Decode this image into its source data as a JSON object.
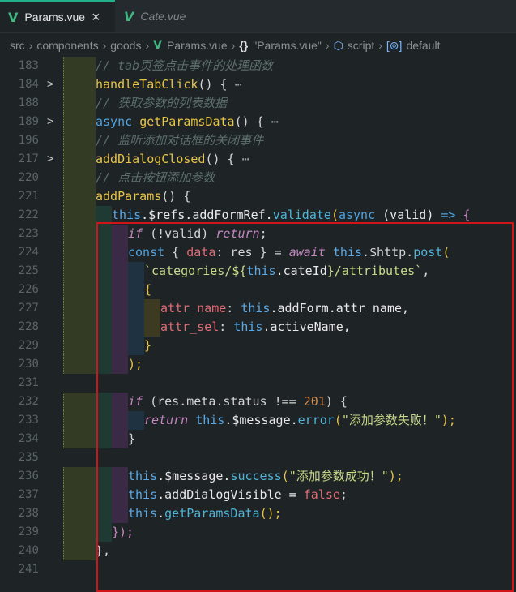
{
  "tabs": [
    {
      "label": "Params.vue",
      "active": true,
      "close": "×",
      "icon": "V"
    },
    {
      "label": "Cate.vue",
      "active": false,
      "icon": "V"
    }
  ],
  "breadcrumb": {
    "items": [
      "src",
      "components",
      "goods",
      "Params.vue",
      "\"Params.vue\"",
      "script",
      "default"
    ],
    "braces": "{}",
    "cube": "⬡",
    "field": "[⊚]"
  },
  "editor": {
    "line_numbers": [
      "183",
      "184",
      "188",
      "189",
      "196",
      "217",
      "220",
      "221",
      "222",
      "223",
      "224",
      "225",
      "226",
      "227",
      "228",
      "229",
      "230",
      "231",
      "232",
      "233",
      "234",
      "235",
      "236",
      "237",
      "238",
      "239",
      "240",
      "241"
    ]
  },
  "code": {
    "l183_comment": "// tab页签点击事件的处理函数",
    "l184_fn": "handleTabClick",
    "l184_rest": "() { ",
    "l184_fold": "⋯",
    "l188_comment": "// 获取参数的列表数据",
    "l189_kw": "async ",
    "l189_fn": "getParamsData",
    "l189_rest": "() { ",
    "l189_fold": "⋯",
    "l196_comment": "// 监听添加对话框的关闭事件",
    "l217_fn": "addDialogClosed",
    "l217_rest": "() { ",
    "l217_fold": "⋯",
    "l220_comment": "// 点击按钮添加参数",
    "l221_fn": "addParams",
    "l221_rest": "() {",
    "l222_this": "this",
    "l222_a": ".$refs.addFormRef.",
    "l222_method": "validate",
    "l222_b": "(",
    "l222_kw": "async",
    "l222_c": " (valid) ",
    "l222_arrow": "=>",
    "l222_d": " {",
    "l223_if": "if",
    "l223_a": " (!valid) ",
    "l223_ret": "return",
    "l223_b": ";",
    "l224_const": "const",
    "l224_a": " { ",
    "l224_key": "data",
    "l224_b": ": res } = ",
    "l224_await": "await",
    "l224_this": " this",
    "l224_c": ".$http.",
    "l224_method": "post",
    "l224_d": "(",
    "l225_str": "`categories/${",
    "l225_this": "this",
    "l225_a": ".cateId",
    "l225_str2": "}/attributes`",
    "l225_b": ",",
    "l226_brace": "{",
    "l227_key": "attr_name",
    "l227_a": ": ",
    "l227_this": "this",
    "l227_b": ".addForm.attr_name,",
    "l228_key": "attr_sel",
    "l228_a": ": ",
    "l228_this": "this",
    "l228_b": ".activeName,",
    "l229_brace": "}",
    "l230_a": ");",
    "l232_if": "if",
    "l232_a": " (res.meta.status ",
    "l232_op": "!==",
    "l232_num": " 201",
    "l232_b": ") {",
    "l233_ret": "return",
    "l233_this": " this",
    "l233_a": ".$message.",
    "l233_method": "error",
    "l233_b": "(",
    "l233_str": "\"添加参数失败！\"",
    "l233_c": ");",
    "l234_a": "}",
    "l236_this": "this",
    "l236_a": ".$message.",
    "l236_method": "success",
    "l236_b": "(",
    "l236_str": "\"添加参数成功！\"",
    "l236_c": ");",
    "l237_this": "this",
    "l237_a": ".addDialogVisible = ",
    "l237_bool": "false",
    "l237_b": ";",
    "l238_this": "this",
    "l238_a": ".",
    "l238_method": "getParamsData",
    "l238_b": "();",
    "l239_a": "});",
    "l240_a": "},"
  },
  "colors": {
    "accent": "#20b08a",
    "highlight_box": "#d01417",
    "vue_green": "#41b883"
  }
}
